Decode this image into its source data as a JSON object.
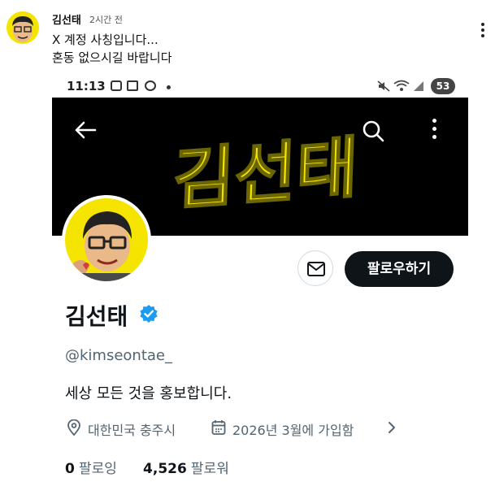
{
  "post": {
    "author": "김선태",
    "time": "2시간 전",
    "text_line1": "X 계정 사칭입니다...",
    "text_line2": "혼동 없으시길 바랍니다",
    "more_icon": "vertical-dots-icon"
  },
  "statusbar": {
    "time": "11:13",
    "battery": "53",
    "icons": [
      "screen-record-icon",
      "gmail-icon",
      "app-icon",
      "mute-icon",
      "wifi-icon",
      "signal-icon"
    ]
  },
  "profile": {
    "banner_text": "김선태",
    "display_name": "김선태",
    "verified": true,
    "handle": "@kimseontae_",
    "bio": "세상 모든 것을 홍보합니다.",
    "location": "대한민국 충주시",
    "joined": "2026년 3월에 가입함",
    "following_count": "0",
    "following_label": "팔로잉",
    "followers_count": "4,526",
    "followers_label": "팔로워",
    "follow_button": "팔로우하기"
  },
  "colors": {
    "accent_black": "#0f1419",
    "secondary_text": "#536471",
    "banner_bg": "#000000",
    "banner_text": "#f5e400",
    "verified_blue": "#1d9bf0"
  }
}
